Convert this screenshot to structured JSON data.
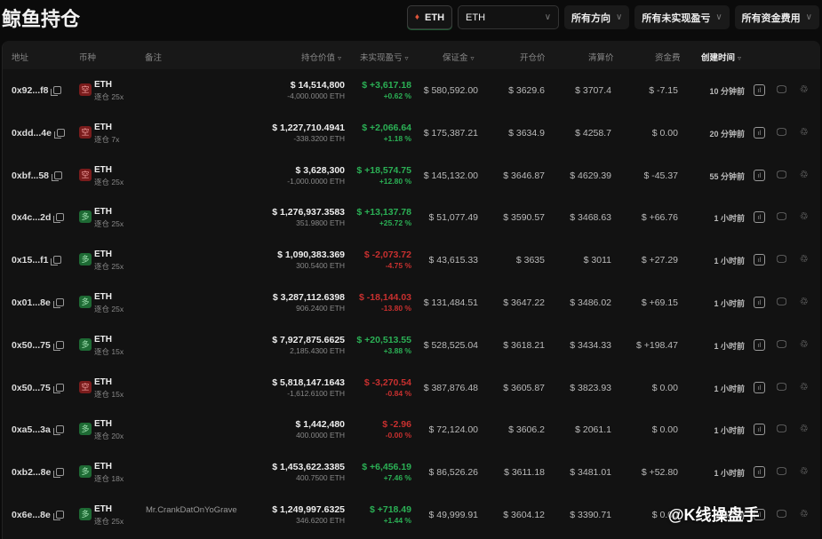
{
  "page": {
    "title": "鲸鱼持仓"
  },
  "filters": {
    "coin_chip": "ETH",
    "coin_select": "ETH",
    "direction": "所有方向",
    "unrealized_pnl": "所有未实现盈亏",
    "funding_fee": "所有资金费用"
  },
  "table": {
    "headers": {
      "address": "地址",
      "coin": "币种",
      "note": "备注",
      "position_value": "持仓价值",
      "unrealized_pnl": "未实现盈亏",
      "margin": "保证金",
      "entry_price": "开仓价",
      "liq_price": "清算价",
      "funding": "资金费",
      "created": "创建时间"
    },
    "rows": [
      {
        "address": "0x92...f8",
        "side": "short",
        "side_label": "空",
        "coin": "ETH",
        "leverage": "逐仓 25x",
        "note": "",
        "value": "$ 14,514,800",
        "size": "-4,000.0000 ETH",
        "pnl": "$ +3,617.18",
        "pnl_pct": "+0.62 %",
        "pnl_sign": "pos",
        "margin": "$ 580,592.00",
        "entry": "$ 3629.6",
        "liq": "$ 3707.4",
        "funding": "$ -7.15",
        "funding_sign": "neg",
        "created": "10 分钟前"
      },
      {
        "address": "0xdd...4e",
        "side": "short",
        "side_label": "空",
        "coin": "ETH",
        "leverage": "逐仓 7x",
        "note": "",
        "value": "$ 1,227,710.4941",
        "size": "-338.3200 ETH",
        "pnl": "$ +2,066.64",
        "pnl_pct": "+1.18 %",
        "pnl_sign": "pos",
        "margin": "$ 175,387.21",
        "entry": "$ 3634.9",
        "liq": "$ 4258.7",
        "funding": "$ 0.00",
        "funding_sign": "zero",
        "created": "20 分钟前"
      },
      {
        "address": "0xbf...58",
        "side": "short",
        "side_label": "空",
        "coin": "ETH",
        "leverage": "逐仓 25x",
        "note": "",
        "value": "$ 3,628,300",
        "size": "-1,000.0000 ETH",
        "pnl": "$ +18,574.75",
        "pnl_pct": "+12.80 %",
        "pnl_sign": "pos",
        "margin": "$ 145,132.00",
        "entry": "$ 3646.87",
        "liq": "$ 4629.39",
        "funding": "$ -45.37",
        "funding_sign": "neg",
        "created": "55 分钟前"
      },
      {
        "address": "0x4c...2d",
        "side": "long",
        "side_label": "多",
        "coin": "ETH",
        "leverage": "逐仓 25x",
        "note": "",
        "value": "$ 1,276,937.3583",
        "size": "351.9800 ETH",
        "pnl": "$ +13,137.78",
        "pnl_pct": "+25.72 %",
        "pnl_sign": "pos",
        "margin": "$ 51,077.49",
        "entry": "$ 3590.57",
        "liq": "$ 3468.63",
        "funding": "$ +66.76",
        "funding_sign": "pos",
        "created": "1 小时前"
      },
      {
        "address": "0x15...f1",
        "side": "long",
        "side_label": "多",
        "coin": "ETH",
        "leverage": "逐仓 25x",
        "note": "",
        "value": "$ 1,090,383.369",
        "size": "300.5400 ETH",
        "pnl": "$ -2,073.72",
        "pnl_pct": "-4.75 %",
        "pnl_sign": "neg",
        "margin": "$ 43,615.33",
        "entry": "$ 3635",
        "liq": "$ 3011",
        "funding": "$ +27.29",
        "funding_sign": "pos",
        "created": "1 小时前"
      },
      {
        "address": "0x01...8e",
        "side": "long",
        "side_label": "多",
        "coin": "ETH",
        "leverage": "逐仓 25x",
        "note": "",
        "value": "$ 3,287,112.6398",
        "size": "906.2400 ETH",
        "pnl": "$ -18,144.03",
        "pnl_pct": "-13.80 %",
        "pnl_sign": "neg",
        "margin": "$ 131,484.51",
        "entry": "$ 3647.22",
        "liq": "$ 3486.02",
        "funding": "$ +69.15",
        "funding_sign": "pos",
        "created": "1 小时前"
      },
      {
        "address": "0x50...75",
        "side": "long",
        "side_label": "多",
        "coin": "ETH",
        "leverage": "逐仓 15x",
        "note": "",
        "value": "$ 7,927,875.6625",
        "size": "2,185.4300 ETH",
        "pnl": "$ +20,513.55",
        "pnl_pct": "+3.88 %",
        "pnl_sign": "pos",
        "margin": "$ 528,525.04",
        "entry": "$ 3618.21",
        "liq": "$ 3434.33",
        "funding": "$ +198.47",
        "funding_sign": "pos",
        "created": "1 小时前"
      },
      {
        "address": "0x50...75",
        "side": "short",
        "side_label": "空",
        "coin": "ETH",
        "leverage": "逐仓 15x",
        "note": "",
        "value": "$ 5,818,147.1643",
        "size": "-1,612.6100 ETH",
        "pnl": "$ -3,270.54",
        "pnl_pct": "-0.84 %",
        "pnl_sign": "neg",
        "margin": "$ 387,876.48",
        "entry": "$ 3605.87",
        "liq": "$ 3823.93",
        "funding": "$ 0.00",
        "funding_sign": "zero",
        "created": "1 小时前"
      },
      {
        "address": "0xa5...3a",
        "side": "long",
        "side_label": "多",
        "coin": "ETH",
        "leverage": "逐仓 20x",
        "note": "",
        "value": "$ 1,442,480",
        "size": "400.0000 ETH",
        "pnl": "$ -2.96",
        "pnl_pct": "-0.00 %",
        "pnl_sign": "neg",
        "margin": "$ 72,124.00",
        "entry": "$ 3606.2",
        "liq": "$ 2061.1",
        "funding": "$ 0.00",
        "funding_sign": "zero",
        "created": "1 小时前"
      },
      {
        "address": "0xb2...8e",
        "side": "long",
        "side_label": "多",
        "coin": "ETH",
        "leverage": "逐仓 18x",
        "note": "",
        "value": "$ 1,453,622.3385",
        "size": "400.7500 ETH",
        "pnl": "$ +6,456.19",
        "pnl_pct": "+7.46 %",
        "pnl_sign": "pos",
        "margin": "$ 86,526.26",
        "entry": "$ 3611.18",
        "liq": "$ 3481.01",
        "funding": "$ +52.80",
        "funding_sign": "pos",
        "created": "1 小时前"
      },
      {
        "address": "0x6e...8e",
        "side": "long",
        "side_label": "多",
        "coin": "ETH",
        "leverage": "逐仓 25x",
        "note": "Mr.CrankDatOnYoGrave",
        "value": "$ 1,249,997.6325",
        "size": "346.6200 ETH",
        "pnl": "$ +718.49",
        "pnl_pct": "+1.44 %",
        "pnl_sign": "pos",
        "margin": "$ 49,999.91",
        "entry": "$ 3604.12",
        "liq": "$ 3390.71",
        "funding": "$ 0.00",
        "funding_sign": "zero",
        "created": "1 小时前"
      }
    ]
  },
  "watermark": "@K线操盘手",
  "colors": {
    "positive": "#2bb055",
    "negative": "#c8302f",
    "background": "#121212"
  }
}
